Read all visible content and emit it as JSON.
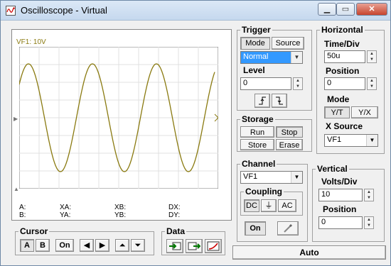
{
  "window": {
    "title": "Oscilloscope - Virtual",
    "min_label": "▁",
    "max_label": "▭",
    "close_label": "✕"
  },
  "screen": {
    "channel_label": "VF1: 10V",
    "trace_color": "#8a7a10"
  },
  "readouts": {
    "a": "A:",
    "b": "B:",
    "xa": "XA:",
    "ya": "YA:",
    "xb": "XB:",
    "yb": "YB:",
    "dx": "DX:",
    "dy": "DY:"
  },
  "trigger": {
    "title": "Trigger",
    "mode_label": "Mode",
    "source_label": "Source",
    "mode_value": "Normal",
    "level_label": "Level",
    "level_value": "0"
  },
  "horizontal": {
    "title": "Horizontal",
    "timediv_label": "Time/Div",
    "timediv_value": "50u",
    "position_label": "Position",
    "position_value": "0",
    "mode_label": "Mode",
    "mode_yt": "Y/T",
    "mode_yx": "Y/X",
    "xsource_label": "X Source",
    "xsource_value": "VF1"
  },
  "storage": {
    "title": "Storage",
    "run": "Run",
    "stop": "Stop",
    "store": "Store",
    "erase": "Erase"
  },
  "channel": {
    "title": "Channel",
    "value": "VF1",
    "coupling_title": "Coupling",
    "dc": "DC",
    "gnd": "⏚",
    "ac": "AC",
    "on_label": "On"
  },
  "vertical": {
    "title": "Vertical",
    "voltsdiv_label": "Volts/Div",
    "voltsdiv_value": "10",
    "position_label": "Position",
    "position_value": "0"
  },
  "cursor": {
    "title": "Cursor",
    "a": "A",
    "b": "B",
    "on": "On",
    "left": "◀",
    "right": "▶",
    "up": "⏶",
    "down": "⏷"
  },
  "data": {
    "title": "Data"
  },
  "auto_label": "Auto"
}
